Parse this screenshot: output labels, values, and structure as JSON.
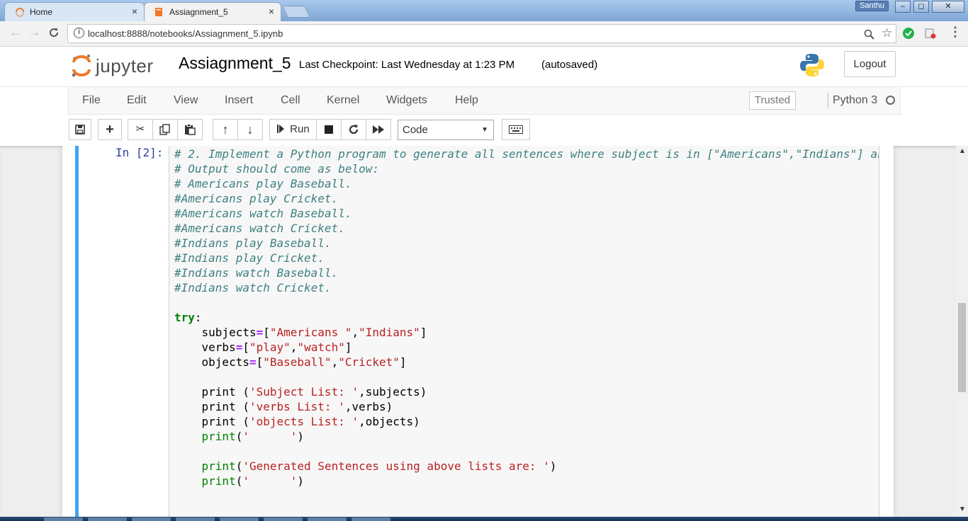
{
  "browser": {
    "tabs": [
      {
        "label": "Home",
        "icon": "jupyter-spinner-icon",
        "close": "×"
      },
      {
        "label": "Assiagnment_5",
        "icon": "notebook-icon",
        "close": "×"
      }
    ],
    "user_badge": "Santhu",
    "window_controls": {
      "minimize": "–",
      "maximize": "◻",
      "close": "✕"
    },
    "url": "localhost:8888/notebooks/Assiagnment_5.ipynb",
    "nav": {
      "back": "←",
      "forward": "→",
      "reload": "C"
    },
    "address_icons": {
      "zoom": "⌕",
      "star": "☆",
      "menu": "⋮"
    }
  },
  "header": {
    "logo_text": "jupyter",
    "notebook_name": "Assiagnment_5",
    "checkpoint": "Last Checkpoint: Last Wednesday at 1:23 PM",
    "autosave": "(autosaved)",
    "logout": "Logout"
  },
  "menubar": {
    "items": [
      "File",
      "Edit",
      "View",
      "Insert",
      "Cell",
      "Kernel",
      "Widgets",
      "Help"
    ],
    "trusted": "Trusted",
    "kernel": "Python 3"
  },
  "toolbar": {
    "run_label": "Run",
    "cell_type": "Code"
  },
  "cell": {
    "prompt": "In [2]:"
  },
  "colors": {
    "cell_border": "#42a5f5",
    "prompt": "#303f9f",
    "comment": "#408080",
    "keyword": "#008000",
    "string": "#ba2121"
  }
}
